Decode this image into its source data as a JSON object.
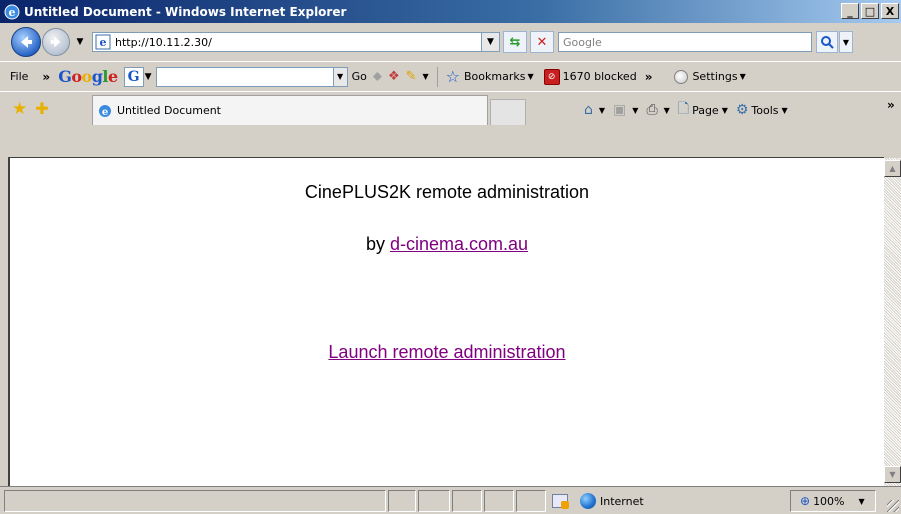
{
  "window": {
    "title": "Untitled Document - Windows Internet Explorer",
    "minimize": "_",
    "maximize": "□",
    "close": "X"
  },
  "address": {
    "url": "http://10.11.2.30/",
    "search_placeholder": "Google"
  },
  "menu": {
    "file": "File",
    "chevron": "»",
    "google_logo": "Google",
    "g_button": "G",
    "go_label": "Go",
    "bookmarks_label": "Bookmarks",
    "blocked_label": "1670 blocked",
    "settings_label": "Settings"
  },
  "tabs": {
    "active_title": "Untitled Document"
  },
  "command_bar": {
    "page_label": "Page",
    "tools_label": "Tools",
    "chevron": "»"
  },
  "page": {
    "heading": "CinePLUS2K remote administration",
    "by_prefix": "by",
    "by_link": "d-cinema.com.au",
    "launch_link": "Launch remote administration"
  },
  "status": {
    "zone_label": "Internet",
    "zoom_label": "100%"
  },
  "colors": {
    "visited_link": "#800080",
    "titlebar_start": "#0a246a",
    "titlebar_end": "#a6caf0"
  },
  "icons": {
    "ie_logo": "ie-logo-icon",
    "back": "back-arrow-icon",
    "forward": "forward-arrow-icon",
    "refresh": "refresh-icon",
    "stop": "stop-icon",
    "search": "search-icon",
    "favorites": "favorites-star-icon",
    "add_favorite": "add-favorite-icon",
    "home": "home-icon",
    "feeds": "feeds-icon",
    "print": "print-icon",
    "page": "page-icon",
    "tools": "tools-gear-icon",
    "globe": "internet-globe-icon",
    "zoom": "zoom-magnifier-icon"
  }
}
